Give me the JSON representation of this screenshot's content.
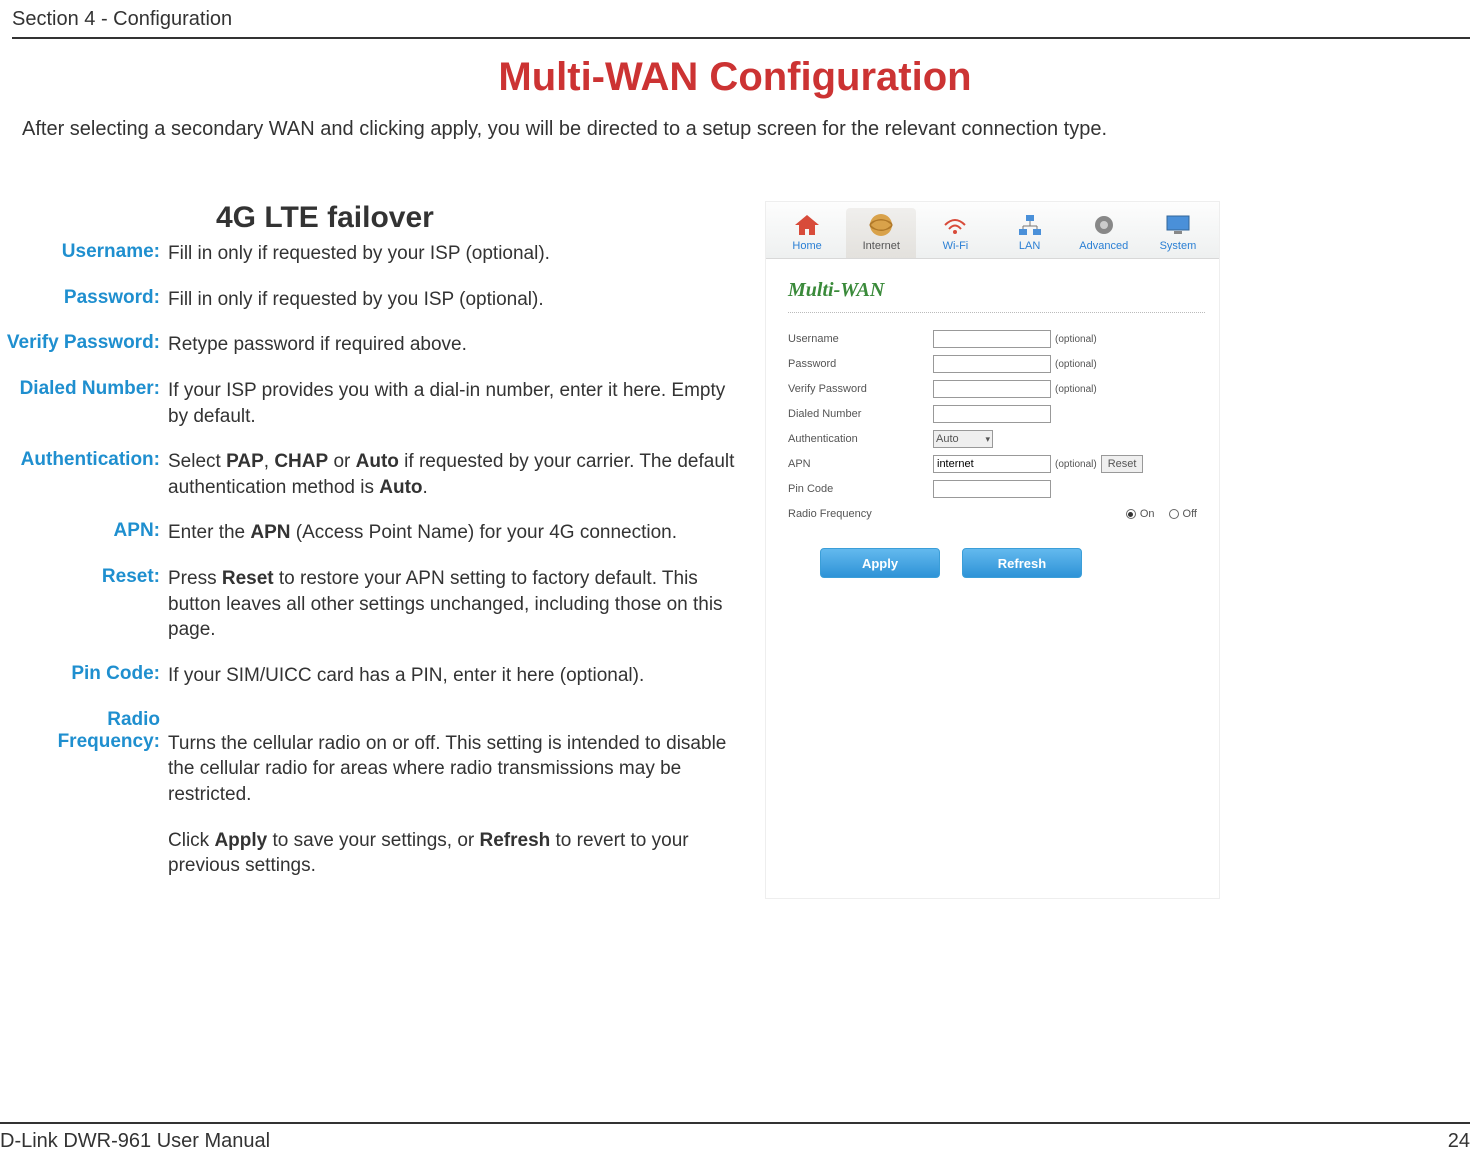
{
  "header": {
    "section": "Section 4 - Configuration"
  },
  "page": {
    "title": "Multi-WAN Configuration",
    "intro": "After selecting a secondary WAN and clicking apply, you will be directed to a setup screen for the relevant connection type.",
    "sub_title": "4G LTE  failover"
  },
  "defs": {
    "username_l": "Username:",
    "username_b": "Fill in only if requested by your ISP (optional).",
    "password_l": "Password:",
    "password_b": "Fill in only if requested by you ISP (optional).",
    "verify_l": "Verify Password:",
    "verify_b": "Retype password if required above.",
    "dialed_l": "Dialed Number:",
    "dialed_b": "If your ISP provides you with a dial-in number, enter it here. Empty by default.",
    "auth_l": "Authentication:",
    "auth_b_pre": "Select ",
    "auth_b_b1": "PAP",
    "auth_b_mid1": ", ",
    "auth_b_b2": "CHAP",
    "auth_b_mid2": " or ",
    "auth_b_b3": "Auto",
    "auth_b_mid3": " if requested by your carrier. The default authentication method is ",
    "auth_b_b4": "Auto",
    "auth_b_post": ".",
    "apn_l": "APN:",
    "apn_b_pre": "Enter the ",
    "apn_b_b1": "APN",
    "apn_b_post": " (Access Point Name) for your 4G connection.",
    "reset_l": "Reset:",
    "reset_b_pre": "Press ",
    "reset_b_b1": "Reset",
    "reset_b_post": " to restore your APN setting to factory default. This button leaves all other settings unchanged, including those on this page.",
    "pin_l": "Pin Code:",
    "pin_b": "If your SIM/UICC card has a PIN, enter it here (optional).",
    "radio_l1": "Radio",
    "radio_l2": "Frequency:",
    "radio_b": "Turns the cellular radio on or off. This setting is intended to disable the cellular radio for areas where radio transmissions may be restricted.",
    "final_pre": "Click ",
    "final_b1": "Apply",
    "final_mid": " to save your settings, or ",
    "final_b2": "Refresh",
    "final_post": " to revert to your previous settings."
  },
  "ui": {
    "nav": {
      "home": "Home",
      "internet": "Internet",
      "wifi": "Wi-Fi",
      "lan": "LAN",
      "advanced": "Advanced",
      "system": "System"
    },
    "panel_title": "Multi-WAN",
    "form": {
      "username": "Username",
      "password": "Password",
      "verify": "Verify Password",
      "dialed": "Dialed Number",
      "auth": "Authentication",
      "auth_val": "Auto",
      "apn": "APN",
      "apn_val": "internet",
      "pin": "Pin Code",
      "radio": "Radio Frequency",
      "optional": "(optional)",
      "on": "On",
      "off": "Off",
      "reset": "Reset"
    },
    "apply": "Apply",
    "refresh": "Refresh"
  },
  "footer": {
    "left": "D-Link DWR-961 User Manual",
    "right": "24"
  }
}
